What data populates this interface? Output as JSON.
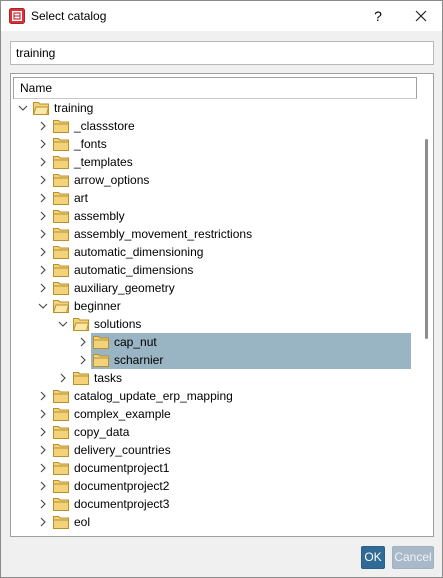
{
  "window": {
    "title": "Select catalog",
    "help_label": "?",
    "search_value": "training"
  },
  "tree": {
    "column_header": "Name",
    "items": [
      {
        "label": "training",
        "level": 0,
        "expanded": true
      },
      {
        "label": "_classstore",
        "level": 1,
        "expanded": false
      },
      {
        "label": "_fonts",
        "level": 1,
        "expanded": false
      },
      {
        "label": "_templates",
        "level": 1,
        "expanded": false
      },
      {
        "label": "arrow_options",
        "level": 1,
        "expanded": false
      },
      {
        "label": "art",
        "level": 1,
        "expanded": false
      },
      {
        "label": "assembly",
        "level": 1,
        "expanded": false
      },
      {
        "label": "assembly_movement_restrictions",
        "level": 1,
        "expanded": false
      },
      {
        "label": "automatic_dimensioning",
        "level": 1,
        "expanded": false
      },
      {
        "label": "automatic_dimensions",
        "level": 1,
        "expanded": false
      },
      {
        "label": "auxiliary_geometry",
        "level": 1,
        "expanded": false
      },
      {
        "label": "beginner",
        "level": 1,
        "expanded": true
      },
      {
        "label": "solutions",
        "level": 2,
        "expanded": true
      },
      {
        "label": "cap_nut",
        "level": 3,
        "expanded": false,
        "selected": true
      },
      {
        "label": "scharnier",
        "level": 3,
        "expanded": false,
        "selected": true
      },
      {
        "label": "tasks",
        "level": 2,
        "expanded": false
      },
      {
        "label": "catalog_update_erp_mapping",
        "level": 1,
        "expanded": false
      },
      {
        "label": "complex_example",
        "level": 1,
        "expanded": false
      },
      {
        "label": "copy_data",
        "level": 1,
        "expanded": false
      },
      {
        "label": "delivery_countries",
        "level": 1,
        "expanded": false
      },
      {
        "label": "documentproject1",
        "level": 1,
        "expanded": false
      },
      {
        "label": "documentproject2",
        "level": 1,
        "expanded": false
      },
      {
        "label": "documentproject3",
        "level": 1,
        "expanded": false
      },
      {
        "label": "eol",
        "level": 1,
        "expanded": false
      }
    ]
  },
  "buttons": {
    "ok_label": "OK",
    "cancel_label": "Cancel"
  },
  "colors": {
    "accent": "#2f6b96",
    "selection": "#99b4c3",
    "folder": "#f3d27a"
  }
}
